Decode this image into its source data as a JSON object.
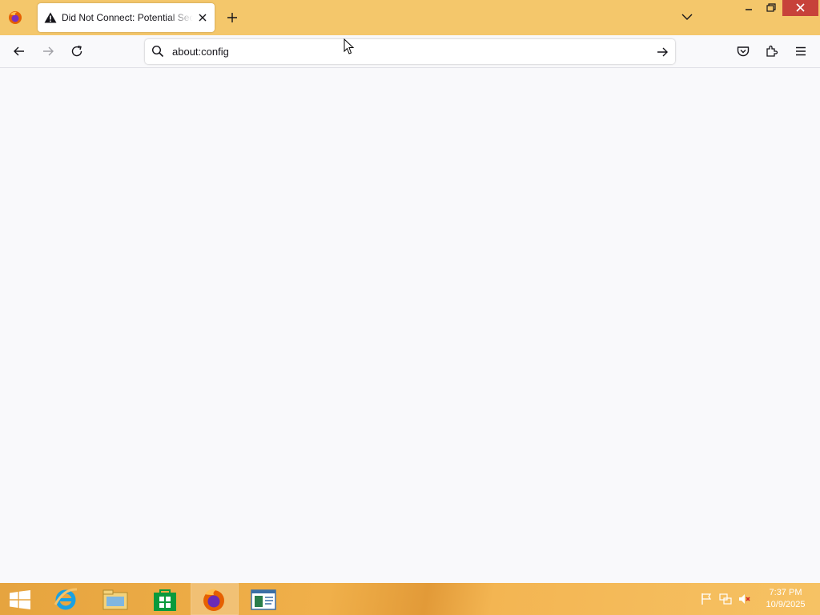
{
  "browser": {
    "tab": {
      "title": "Did Not Connect: Potential Security Issue",
      "status_icon": "warning-icon"
    },
    "url": "about:config",
    "colors": {
      "titlebar": "#f4c76b",
      "close_button": "#c7423a",
      "content": "#f9f9fb"
    }
  },
  "taskbar": {
    "apps": [
      "start-icon",
      "internet-explorer-icon",
      "file-explorer-icon",
      "store-icon",
      "firefox-icon",
      "notepad-app-icon"
    ],
    "tray": [
      "flag-icon",
      "network-icon",
      "volume-muted-icon"
    ],
    "clock": {
      "time": "7:37 PM",
      "date": "10/9/2025"
    }
  }
}
